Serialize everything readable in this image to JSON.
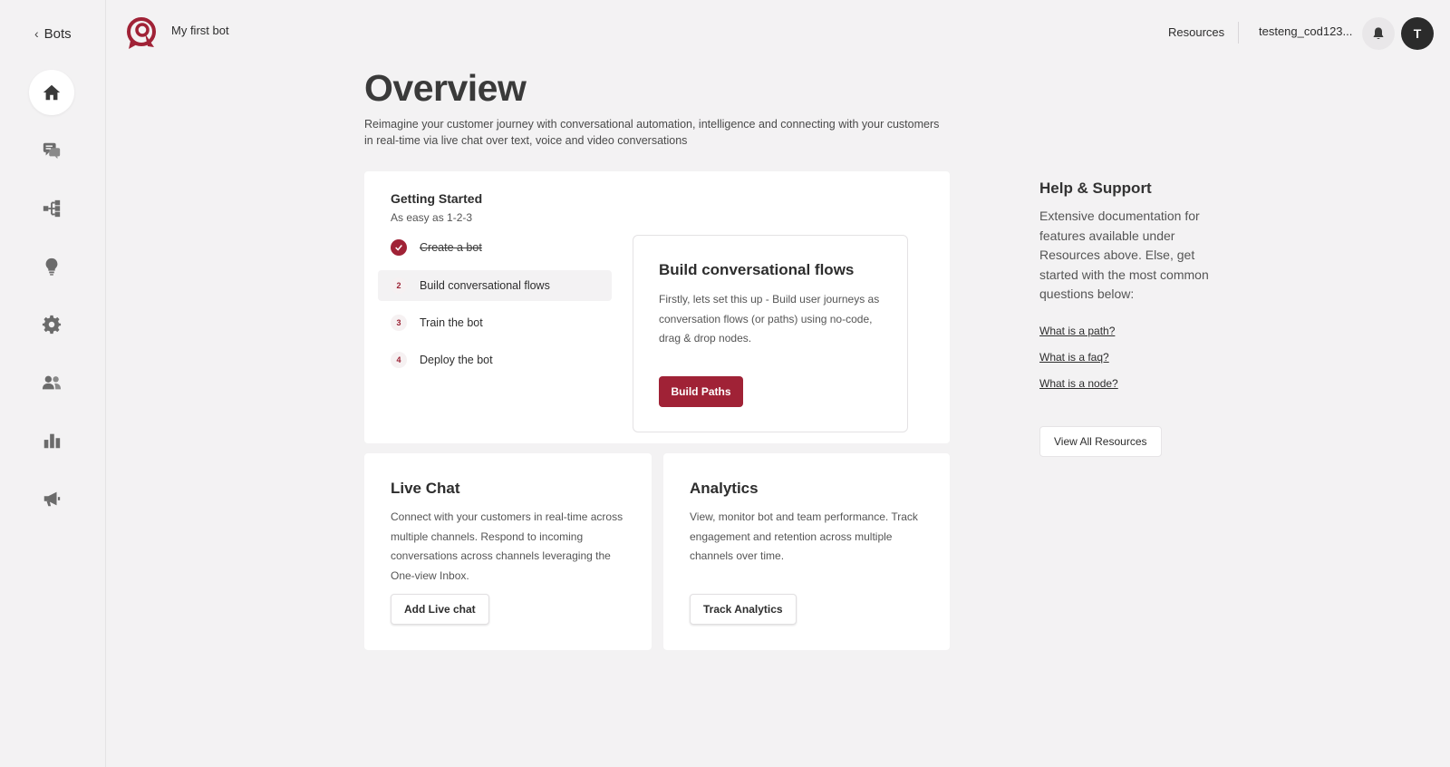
{
  "nav": {
    "back_label": "Bots",
    "items": [
      {
        "name": "home",
        "active": true
      },
      {
        "name": "live-chat"
      },
      {
        "name": "paths"
      },
      {
        "name": "training"
      },
      {
        "name": "settings"
      },
      {
        "name": "team"
      },
      {
        "name": "analytics"
      },
      {
        "name": "broadcast"
      }
    ]
  },
  "header": {
    "bot_name": "My first bot",
    "resources_label": "Resources",
    "user_label": "testeng_cod123...",
    "avatar_initial": "T"
  },
  "overview": {
    "title": "Overview",
    "description": "Reimagine your customer journey with conversational automation, intelligence and connecting with your customers in real-time via live chat over text, voice and video conversations"
  },
  "getting_started": {
    "title": "Getting Started",
    "subtitle": "As easy as 1-2-3",
    "steps": [
      {
        "num": "",
        "label": "Create a bot",
        "done": true
      },
      {
        "num": "2",
        "label": "Build conversational flows",
        "active": true
      },
      {
        "num": "3",
        "label": "Train the bot"
      },
      {
        "num": "4",
        "label": "Deploy the bot"
      }
    ],
    "detail": {
      "title": "Build conversational flows",
      "description": "Firstly, lets set this up - Build user journeys as conversation flows (or paths) using no-code, drag & drop nodes.",
      "button": "Build Paths"
    }
  },
  "live_chat": {
    "title": "Live Chat",
    "description": "Connect with your customers in real-time across multiple channels. Respond to incoming conversations across channels leveraging the One-view Inbox.",
    "button": "Add Live chat"
  },
  "analytics": {
    "title": "Analytics",
    "description": "View, monitor bot and team performance. Track engagement and retention across multiple channels over time.",
    "button": "Track Analytics"
  },
  "help": {
    "title": "Help & Support",
    "description": "Extensive documentation for features available under Resources above. Else, get started with the most common questions below:",
    "links": [
      "What is a path?",
      "What is a faq?",
      "What is a node?"
    ],
    "button": "View All Resources"
  },
  "colors": {
    "accent": "#a02236",
    "background": "#f3f2f3",
    "icon": "#6b6b6b"
  }
}
